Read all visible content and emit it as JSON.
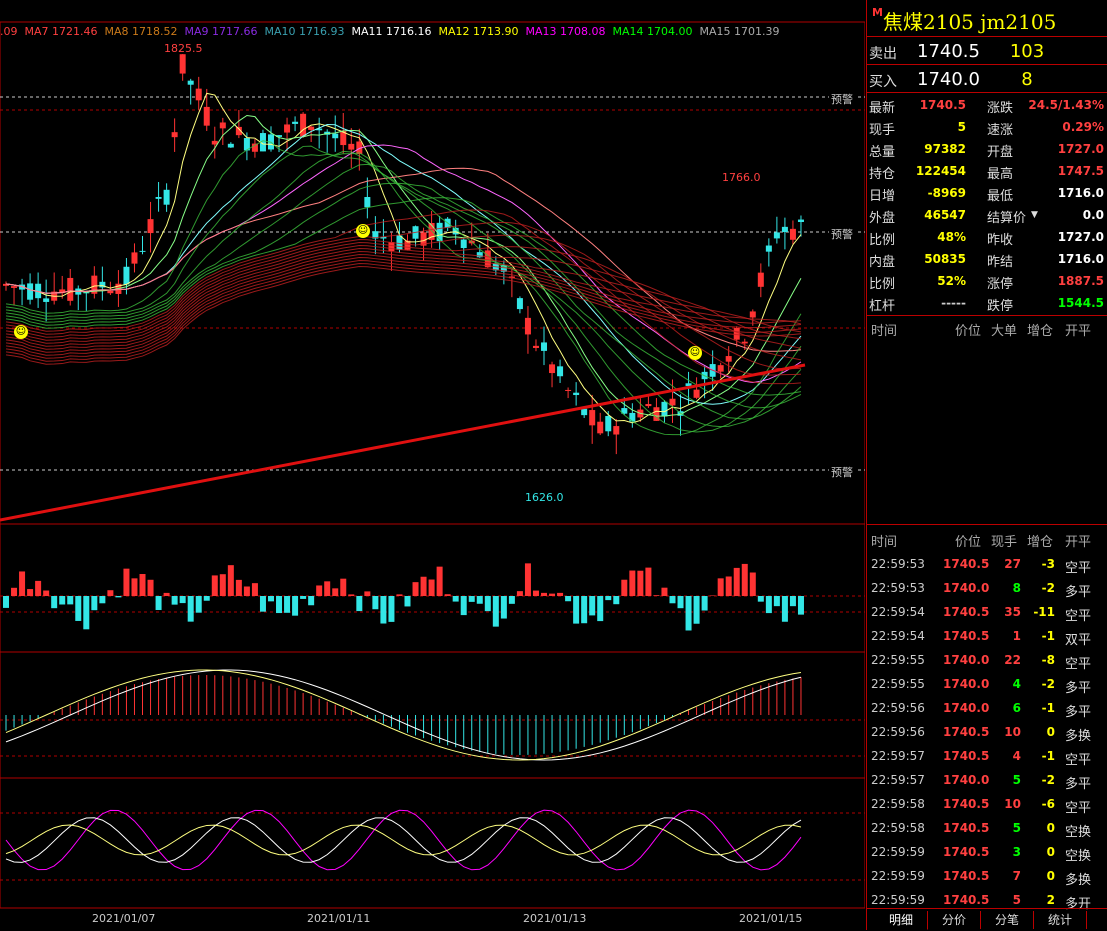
{
  "ma_legend": [
    {
      "text": ".09",
      "color": "#ff4040"
    },
    {
      "text": "MA7 1721.46",
      "color": "#ff4040"
    },
    {
      "text": "MA8 1718.52",
      "color": "#cc7a1a"
    },
    {
      "text": "MA9 1717.66",
      "color": "#8a2be2"
    },
    {
      "text": "MA10 1716.93",
      "color": "#3aa0b0"
    },
    {
      "text": "MA11 1716.16",
      "color": "#ffffff"
    },
    {
      "text": "MA12 1713.90",
      "color": "#ffff00"
    },
    {
      "text": "MA13 1708.08",
      "color": "#ff00ff"
    },
    {
      "text": "MA14 1704.00",
      "color": "#00ff00"
    },
    {
      "text": "MA15 1701.39",
      "color": "#aaaaaa"
    }
  ],
  "chart": {
    "high_label": "1825.5",
    "low_label": "1626.0",
    "peak2_label": "1766.0",
    "warning_label": "预警",
    "dates": [
      "2021/01/07",
      "2021/01/11",
      "2021/01/13",
      "2021/01/15"
    ],
    "colors": {
      "up": "#ff3333",
      "down": "#33e6e6",
      "grid": "#b00000"
    }
  },
  "chart_data": {
    "type": "candlestick",
    "title": "",
    "xlabel": "",
    "ylabel": "",
    "ylim": [
      1610,
      1840
    ],
    "annotations": [
      "1825.5",
      "1626.0",
      "1766.0"
    ],
    "values": [
      1721.46,
      1718.52,
      1717.66,
      1716.93,
      1716.16,
      1713.9,
      1708.08,
      1704.0,
      1701.39
    ]
  },
  "panel": {
    "code_flag": "M",
    "title": "焦煤2105  jm2105",
    "sell": {
      "label": "卖出",
      "price": "1740.5",
      "vol": "103"
    },
    "buy": {
      "label": "买入",
      "price": "1740.0",
      "vol": "8"
    },
    "stats": [
      {
        "l1": "最新",
        "v1": "1740.5",
        "c1": "#ff4040",
        "l2": "涨跌",
        "v2": "24.5/1.43%",
        "c2": "#ff4040"
      },
      {
        "l1": "现手",
        "v1": "5",
        "c1": "#ffff00",
        "l2": "速涨",
        "v2": "0.29%",
        "c2": "#ff4040"
      },
      {
        "l1": "总量",
        "v1": "97382",
        "c1": "#ffff00",
        "l2": "开盘",
        "v2": "1727.0",
        "c2": "#ff4040"
      },
      {
        "l1": "持仓",
        "v1": "122454",
        "c1": "#ffff00",
        "l2": "最高",
        "v2": "1747.5",
        "c2": "#ff4040"
      },
      {
        "l1": "日增",
        "v1": "-8969",
        "c1": "#ffff00",
        "l2": "最低",
        "v2": "1716.0",
        "c2": "#ffffff"
      },
      {
        "l1": "外盘",
        "v1": "46547",
        "c1": "#ffff00",
        "l2": "结算价",
        "v2": "0.0",
        "c2": "#ffffff"
      },
      {
        "l1": "比例",
        "v1": "48%",
        "c1": "#ffff00",
        "l2": "昨收",
        "v2": "1727.0",
        "c2": "#ffffff"
      },
      {
        "l1": "内盘",
        "v1": "50835",
        "c1": "#ffff00",
        "l2": "昨结",
        "v2": "1716.0",
        "c2": "#ffffff"
      },
      {
        "l1": "比例",
        "v1": "52%",
        "c1": "#ffff00",
        "l2": "涨停",
        "v2": "1887.5",
        "c2": "#ff4040"
      },
      {
        "l1": "杠杆",
        "v1": "-----",
        "c1": "#cccccc",
        "l2": "跌停",
        "v2": "1544.5",
        "c2": "#00ff00"
      }
    ],
    "big_order_headers": [
      "时间",
      "价位",
      "大单",
      "增仓",
      "开平"
    ],
    "tick_headers": [
      "时间",
      "价位",
      "现手",
      "增仓",
      "开平"
    ],
    "ticks": [
      {
        "t": "22:59:53",
        "p": "1740.5",
        "v": "27",
        "oi": "-3",
        "k": "空平",
        "pc": "#ff4040",
        "vc": "#ff4040"
      },
      {
        "t": "22:59:53",
        "p": "1740.0",
        "v": "8",
        "oi": "-2",
        "k": "多平",
        "pc": "#ff4040",
        "vc": "#00ff00"
      },
      {
        "t": "22:59:54",
        "p": "1740.5",
        "v": "35",
        "oi": "-11",
        "k": "空平",
        "pc": "#ff4040",
        "vc": "#ff4040"
      },
      {
        "t": "22:59:54",
        "p": "1740.5",
        "v": "1",
        "oi": "-1",
        "k": "双平",
        "pc": "#ff4040",
        "vc": "#ff4040"
      },
      {
        "t": "22:59:55",
        "p": "1740.0",
        "v": "22",
        "oi": "-8",
        "k": "空平",
        "pc": "#ff4040",
        "vc": "#ff4040"
      },
      {
        "t": "22:59:55",
        "p": "1740.0",
        "v": "4",
        "oi": "-2",
        "k": "多平",
        "pc": "#ff4040",
        "vc": "#00ff00"
      },
      {
        "t": "22:59:56",
        "p": "1740.0",
        "v": "6",
        "oi": "-1",
        "k": "多平",
        "pc": "#ff4040",
        "vc": "#00ff00"
      },
      {
        "t": "22:59:56",
        "p": "1740.5",
        "v": "10",
        "oi": "0",
        "k": "多换",
        "pc": "#ff4040",
        "vc": "#ff4040"
      },
      {
        "t": "22:59:57",
        "p": "1740.5",
        "v": "4",
        "oi": "-1",
        "k": "空平",
        "pc": "#ff4040",
        "vc": "#ff4040"
      },
      {
        "t": "22:59:57",
        "p": "1740.0",
        "v": "5",
        "oi": "-2",
        "k": "多平",
        "pc": "#ff4040",
        "vc": "#00ff00"
      },
      {
        "t": "22:59:58",
        "p": "1740.5",
        "v": "10",
        "oi": "-6",
        "k": "空平",
        "pc": "#ff4040",
        "vc": "#ff4040"
      },
      {
        "t": "22:59:58",
        "p": "1740.5",
        "v": "5",
        "oi": "0",
        "k": "空换",
        "pc": "#ff4040",
        "vc": "#00ff00"
      },
      {
        "t": "22:59:59",
        "p": "1740.5",
        "v": "3",
        "oi": "0",
        "k": "空换",
        "pc": "#ff4040",
        "vc": "#00ff00"
      },
      {
        "t": "22:59:59",
        "p": "1740.5",
        "v": "7",
        "oi": "0",
        "k": "多换",
        "pc": "#ff4040",
        "vc": "#ff4040"
      },
      {
        "t": "22:59:59",
        "p": "1740.5",
        "v": "5",
        "oi": "2",
        "k": "多开",
        "pc": "#ff4040",
        "vc": "#ff4040"
      }
    ],
    "tabs": [
      "明细",
      "分价",
      "分笔",
      "统计"
    ]
  }
}
